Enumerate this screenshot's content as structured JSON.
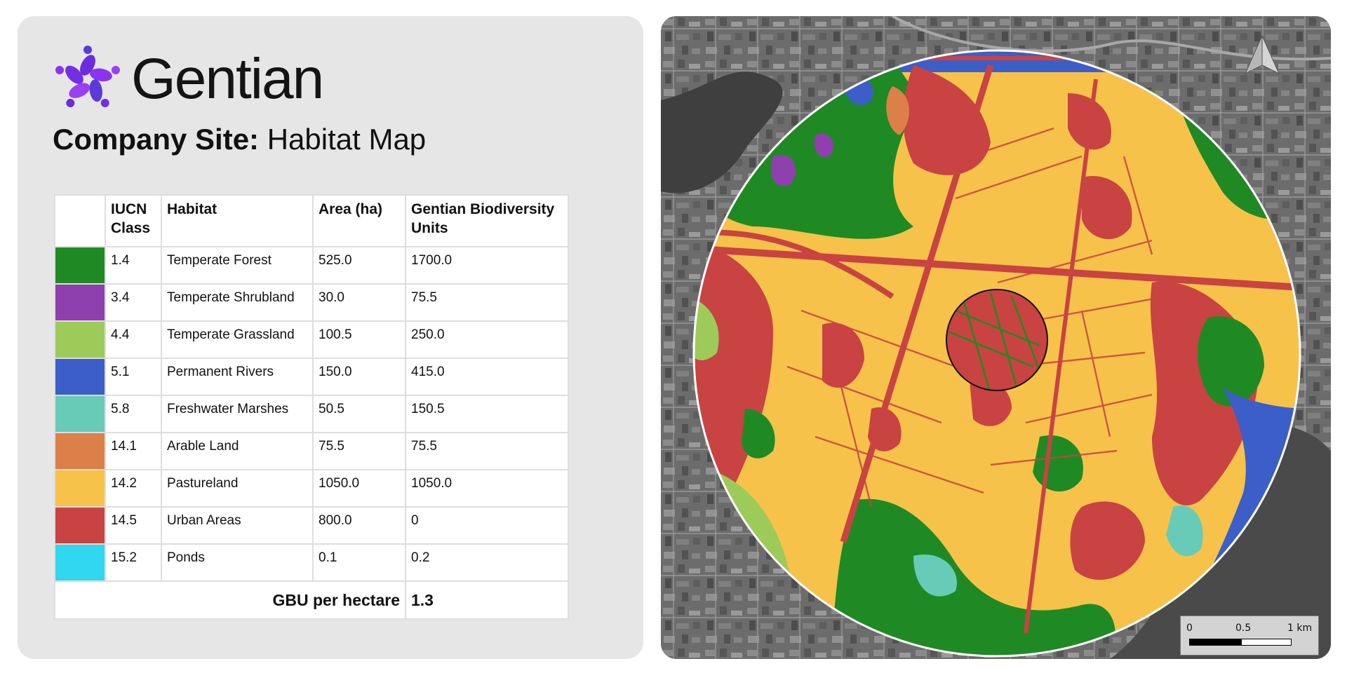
{
  "brand": {
    "name": "Gentian",
    "accent": "#7a2be0"
  },
  "title": {
    "bold": "Company Site:",
    "normal": "Habitat Map"
  },
  "table": {
    "headers": [
      "",
      "IUCN Class",
      "Habitat",
      "Area (ha)",
      "Gentian Biodiversity Units"
    ],
    "rows": [
      {
        "color": "#1f8a24",
        "iucn": "1.4",
        "habitat": "Temperate Forest",
        "area": "525.0",
        "gbu": "1700.0"
      },
      {
        "color": "#8f3fae",
        "iucn": "3.4",
        "habitat": "Temperate Shrubland",
        "area": "30.0",
        "gbu": "75.5"
      },
      {
        "color": "#9ccb5a",
        "iucn": "4.4",
        "habitat": "Temperate Grassland",
        "area": "100.5",
        "gbu": "250.0"
      },
      {
        "color": "#3c5ec9",
        "iucn": "5.1",
        "habitat": "Permanent Rivers",
        "area": "150.0",
        "gbu": "415.0"
      },
      {
        "color": "#68cbb8",
        "iucn": "5.8",
        "habitat": "Freshwater Marshes",
        "area": "50.5",
        "gbu": "150.5"
      },
      {
        "color": "#dd7f48",
        "iucn": "14.1",
        "habitat": "Arable Land",
        "area": "75.5",
        "gbu": "75.5"
      },
      {
        "color": "#f7c24a",
        "iucn": "14.2",
        "habitat": "Pastureland",
        "area": "1050.0",
        "gbu": "1050.0"
      },
      {
        "color": "#c84342",
        "iucn": "14.5",
        "habitat": "Urban Areas",
        "area": "800.0",
        "gbu": "0"
      },
      {
        "color": "#31d6ef",
        "iucn": "15.2",
        "habitat": "Ponds",
        "area": "0.1",
        "gbu": "0.2"
      }
    ],
    "total": {
      "label": "GBU per hectare",
      "value": "1.3"
    }
  },
  "map": {
    "scale_labels": [
      "0",
      "0.5",
      "1 km"
    ],
    "north_arrow_icon": "north-arrow-icon"
  }
}
